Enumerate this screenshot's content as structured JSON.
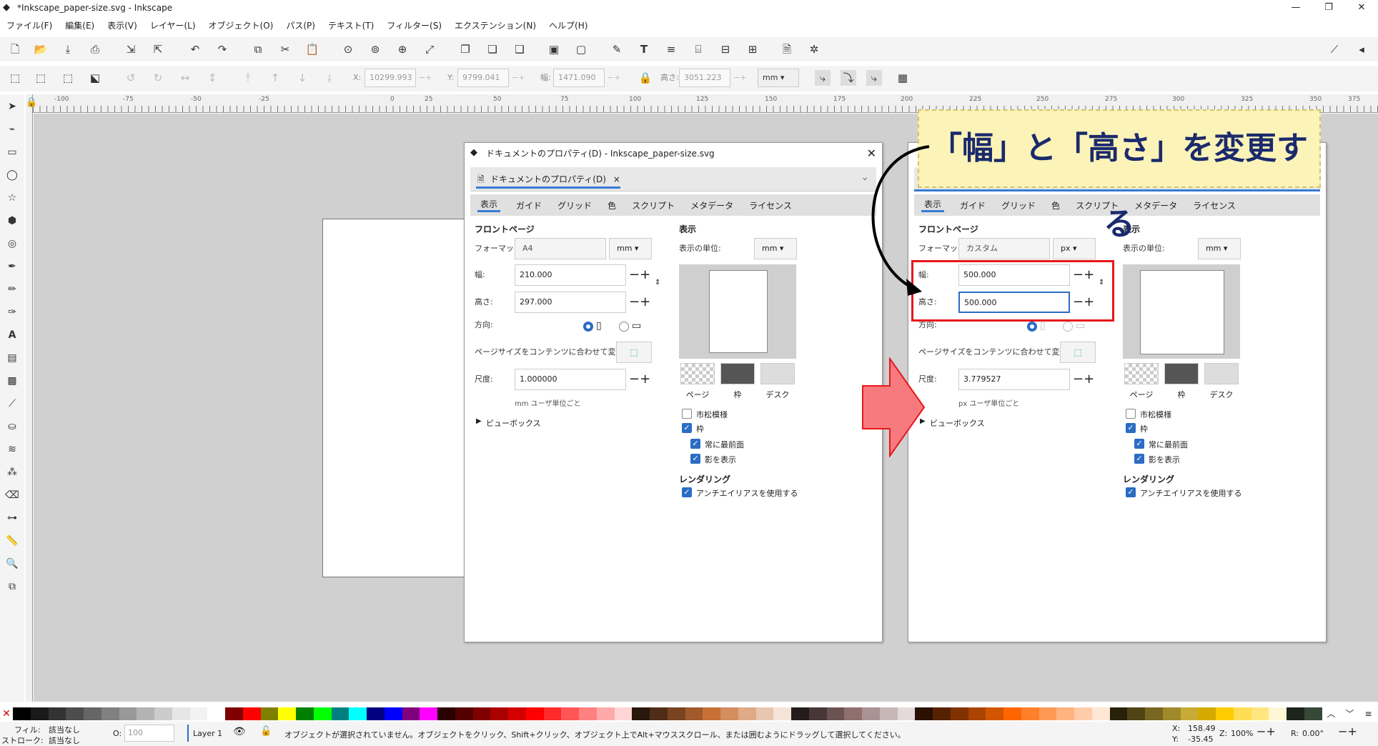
{
  "window": {
    "title": "*Inkscape_paper-size.svg - Inkscape",
    "controls": [
      "—",
      "❐",
      "✕"
    ]
  },
  "menu": [
    "ファイル(F)",
    "編集(E)",
    "表示(V)",
    "レイヤー(L)",
    "オブジェクト(O)",
    "パス(P)",
    "テキスト(T)",
    "フィルター(S)",
    "エクステンション(N)",
    "ヘルプ(H)"
  ],
  "toolbar2": {
    "x_label": "X:",
    "x": "10299.993",
    "y_label": "Y:",
    "y": "9799.041",
    "w_label": "幅:",
    "w": "1471.090",
    "h_label": "高さ:",
    "h": "3051.223",
    "unit": "mm"
  },
  "ruler_ticks": [
    "-100",
    "-75",
    "-50",
    "-25",
    "0",
    "25",
    "50",
    "75",
    "100",
    "125",
    "150",
    "175",
    "200",
    "225",
    "250",
    "275",
    "300",
    "325",
    "350",
    "375"
  ],
  "dialog_left": {
    "title": "ドキュメントのプロパティ(D) - Inkscape_paper-size.svg",
    "doc_tab": "ドキュメントのプロパティ(D)",
    "tabs": [
      "表示",
      "ガイド",
      "グリッド",
      "色",
      "スクリプト",
      "メタデータ",
      "ライセンス"
    ],
    "front_page": "フロントページ",
    "format_label": "フォーマット:",
    "format": "A4",
    "format_unit": "mm",
    "width_label": "幅:",
    "width": "210.000",
    "height_label": "高さ:",
    "height": "297.000",
    "orient_label": "方向:",
    "fit_label": "ページサイズをコンテンツに合わせて変更:",
    "scale_label": "尺度:",
    "scale": "1.000000",
    "unit_note": "mm ユーザ単位ごと",
    "viewbox": "ビューボックス",
    "display": "表示",
    "display_unit_label": "表示の単位:",
    "display_unit": "mm",
    "swatches": [
      "ページ",
      "枠",
      "デスク"
    ],
    "checker": "市松模様",
    "border": "枠",
    "border_top": "常に最前面",
    "shadow": "影を表示",
    "rendering": "レンダリング",
    "antialias": "アンチエイリアスを使用する"
  },
  "dialog_right": {
    "tabs": [
      "表示",
      "ガイド",
      "グリッド",
      "色",
      "スクリプト",
      "メタデータ",
      "ライセンス"
    ],
    "front_page": "フロントページ",
    "format_label": "フォーマット:",
    "format": "カスタム",
    "format_unit": "px",
    "width_label": "幅:",
    "width": "500.000",
    "height_label": "高さ:",
    "height": "500.000",
    "orient_label": "方向:",
    "fit_label": "ページサイズをコンテンツに合わせて変更:",
    "scale_label": "尺度:",
    "scale": "3.779527",
    "unit_note": "px ユーザ単位ごと",
    "viewbox": "ビューボックス",
    "display": "表示",
    "display_unit_label": "表示の単位:",
    "display_unit": "mm",
    "swatches": [
      "ページ",
      "枠",
      "デスク"
    ],
    "checker": "市松模様",
    "border": "枠",
    "border_top": "常に最前面",
    "shadow": "影を表示",
    "rendering": "レンダリング",
    "antialias": "アンチエイリアスを使用する"
  },
  "callout": "「幅」と「高さ」を変更する",
  "status": {
    "fill_label": "フィル:",
    "fill": "該当なし",
    "stroke_label": "ストローク:",
    "stroke": "該当なし",
    "opacity_label": "O:",
    "opacity": "100",
    "layer": "Layer 1",
    "message": "オブジェクトが選択されていません。オブジェクトをクリック、Shift+クリック、オブジェクト上でAlt+マウススクロール、または囲むようにドラッグして選択してください。",
    "x_label": "X:",
    "x": "158.49",
    "y_label": "Y:",
    "y": "-35.45",
    "zoom_label": "Z:",
    "zoom": "100%",
    "rot_label": "R:",
    "rot": "0.00°"
  },
  "colors": {
    "accent": "#2b6cc4",
    "highlight_box": "#e8161b",
    "callout_bg": "#fbf3b8",
    "callout_text": "#1a2a6c",
    "arrow": "#f77b7e"
  }
}
